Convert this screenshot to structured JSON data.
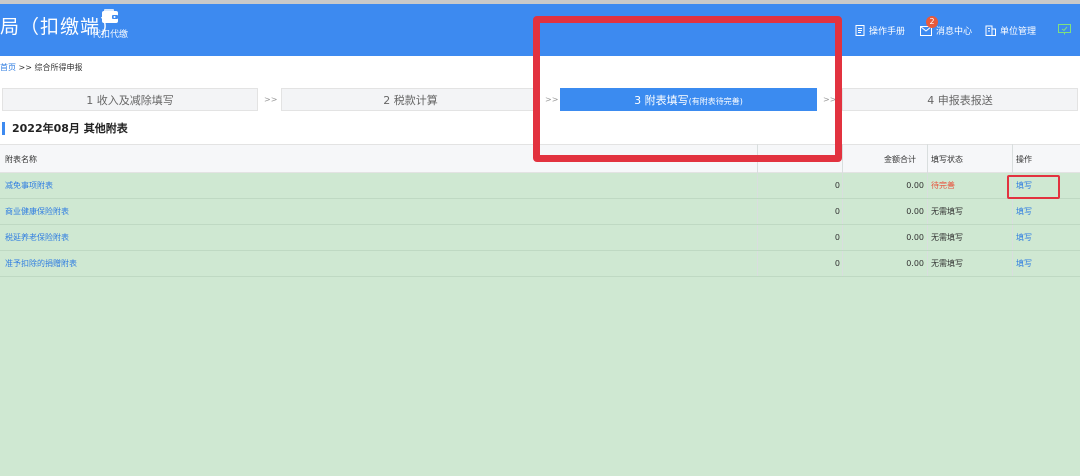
{
  "header": {
    "app_title_fragment": "局（扣缴端）",
    "nav_agent_label": "代扣代缴",
    "manual_label": "操作手册",
    "messages_label": "消息中心",
    "messages_badge": "2",
    "unit_label": "单位管理",
    "accent_color": "#3d8af0"
  },
  "breadcrumb": {
    "home": "首页",
    "separator": ">>",
    "current": "综合所得申报"
  },
  "steps": [
    {
      "label": "1 收入及减除填写",
      "note": "",
      "active": false
    },
    {
      "label": "2 税款计算",
      "note": "",
      "active": false
    },
    {
      "label": "3 附表填写",
      "note": "(有附表待完善)",
      "active": true
    },
    {
      "label": "4 申报表报送",
      "note": "",
      "active": false
    }
  ],
  "step_separator": ">>",
  "section_title": "2022年08月  其他附表",
  "table": {
    "headers": {
      "name": "附表名称",
      "count": "",
      "total": "金额合计",
      "status": "填写状态",
      "op": "操作"
    },
    "rows": [
      {
        "name": "减免事项附表",
        "count": "0",
        "total": "0.00",
        "status": "待完善",
        "op": "填写"
      },
      {
        "name": "商业健康保险附表",
        "count": "0",
        "total": "0.00",
        "status": "无需填写",
        "op": "填写"
      },
      {
        "name": "税延养老保险附表",
        "count": "0",
        "total": "0.00",
        "status": "无需填写",
        "op": "填写"
      },
      {
        "name": "准予扣除的捐赠附表",
        "count": "0",
        "total": "0.00",
        "status": "无需填写",
        "op": "填写"
      }
    ]
  },
  "colors": {
    "pending_status": "#e8503a",
    "normal_status": "#333333",
    "highlight": "#e2323f",
    "table_bg": "#cfe8d2"
  }
}
